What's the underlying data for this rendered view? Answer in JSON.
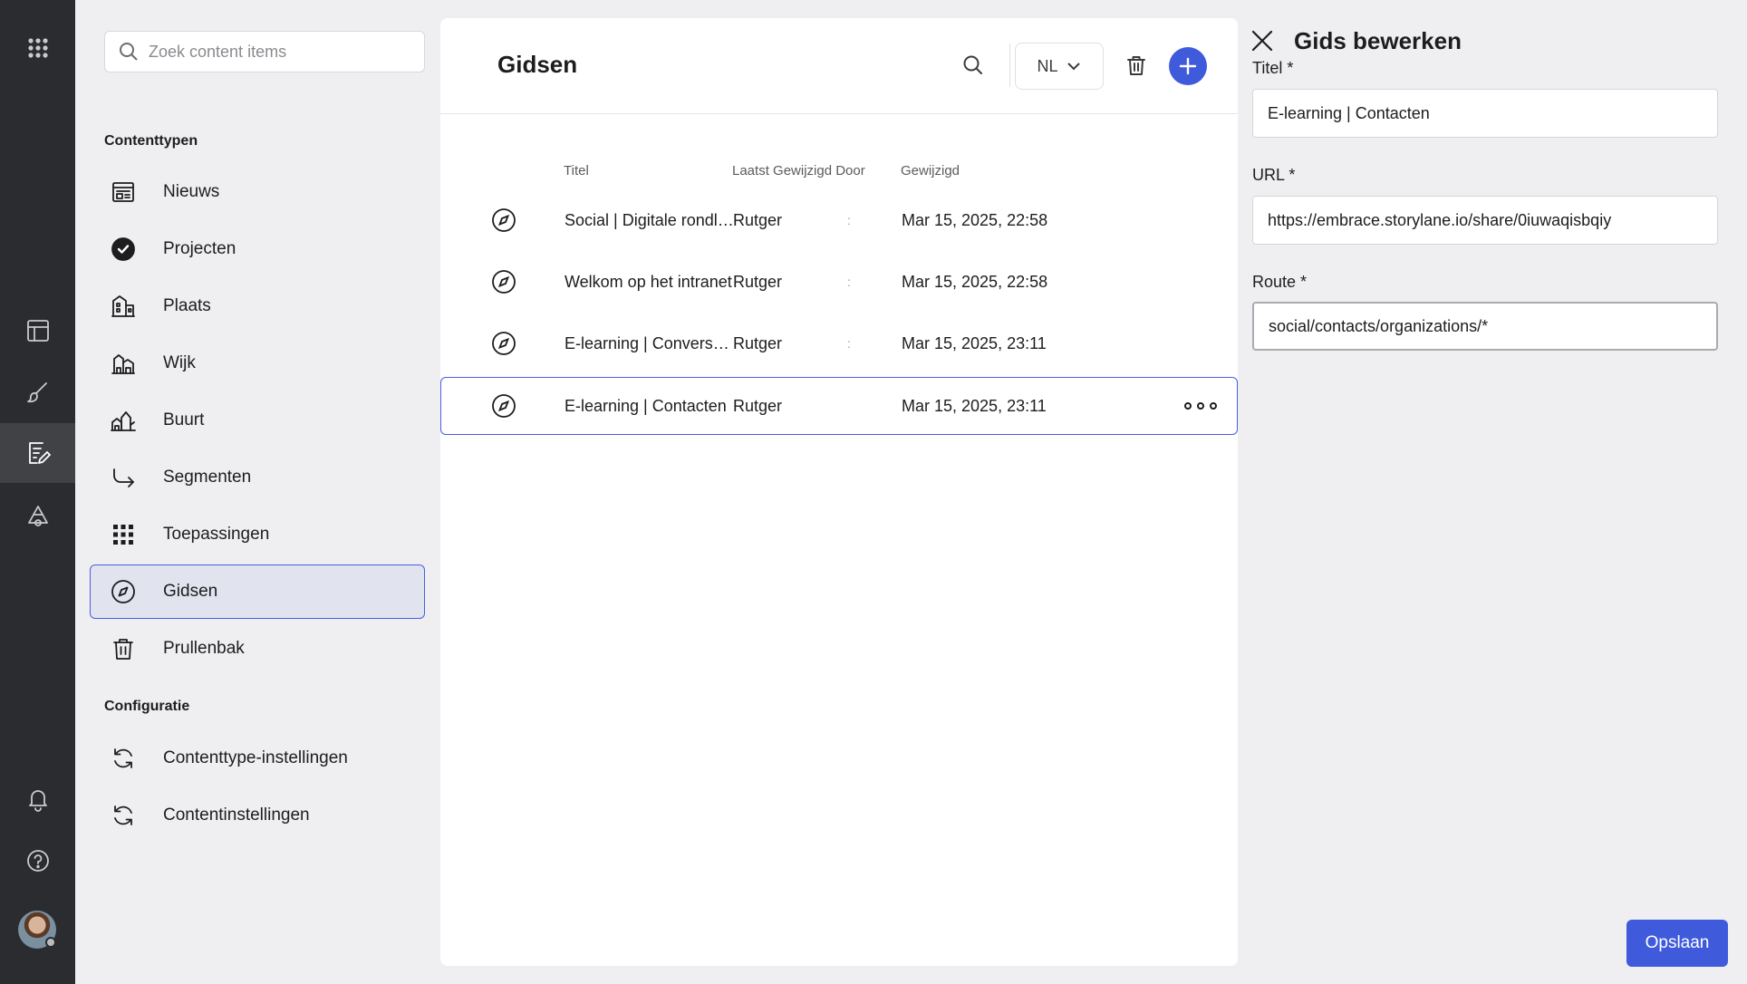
{
  "sidebar": {
    "search_placeholder": "Zoek content items",
    "section_content": "Contenttypen",
    "section_config": "Configuratie",
    "items": [
      {
        "label": "Nieuws",
        "icon": "news-icon"
      },
      {
        "label": "Projecten",
        "icon": "check-circle-icon"
      },
      {
        "label": "Plaats",
        "icon": "buildings-icon"
      },
      {
        "label": "Wijk",
        "icon": "district-icon"
      },
      {
        "label": "Buurt",
        "icon": "neighborhood-icon"
      },
      {
        "label": "Segmenten",
        "icon": "arrow-turn-icon"
      },
      {
        "label": "Toepassingen",
        "icon": "grid-icon"
      },
      {
        "label": "Gidsen",
        "icon": "compass-icon",
        "selected": true
      },
      {
        "label": "Prullenbak",
        "icon": "trash-icon"
      }
    ],
    "config_items": [
      {
        "label": "Contenttype-instellingen",
        "icon": "sync-icon"
      },
      {
        "label": "Contentinstellingen",
        "icon": "sync-icon"
      }
    ]
  },
  "panel": {
    "title": "Gidsen",
    "language": "NL",
    "columns": {
      "title": "Titel",
      "modified_by": "Laatst Gewijzigd Door",
      "modified": "Gewijzigd"
    },
    "rows": [
      {
        "title": "Social | Digitale rondleiding",
        "by": "Rutger",
        "sep": ":",
        "date": "Mar 15, 2025, 22:58"
      },
      {
        "title": "Welkom op het intranet",
        "by": "Rutger",
        "sep": ":",
        "date": "Mar 15, 2025, 22:58"
      },
      {
        "title": "E-learning | Conversaties",
        "by": "Rutger",
        "sep": ":",
        "date": "Mar 15, 2025, 23:11"
      },
      {
        "title": "E-learning | Contacten",
        "by": "Rutger",
        "sep": "",
        "date": "Mar 15, 2025, 23:11",
        "selected": true
      }
    ]
  },
  "editor": {
    "title": "Gids bewerken",
    "fields": {
      "titel_label": "Titel *",
      "titel_value": "E-learning | Contacten",
      "url_label": "URL *",
      "url_value": "https://embrace.storylane.io/share/0iuwaqisbqiy",
      "route_label": "Route *",
      "route_value": "social/contacts/organizations/*"
    },
    "save_label": "Opslaan"
  },
  "colors": {
    "accent": "#3f5bdc",
    "rail": "#2b2c2f",
    "selected_bg": "#e1e3ef"
  }
}
